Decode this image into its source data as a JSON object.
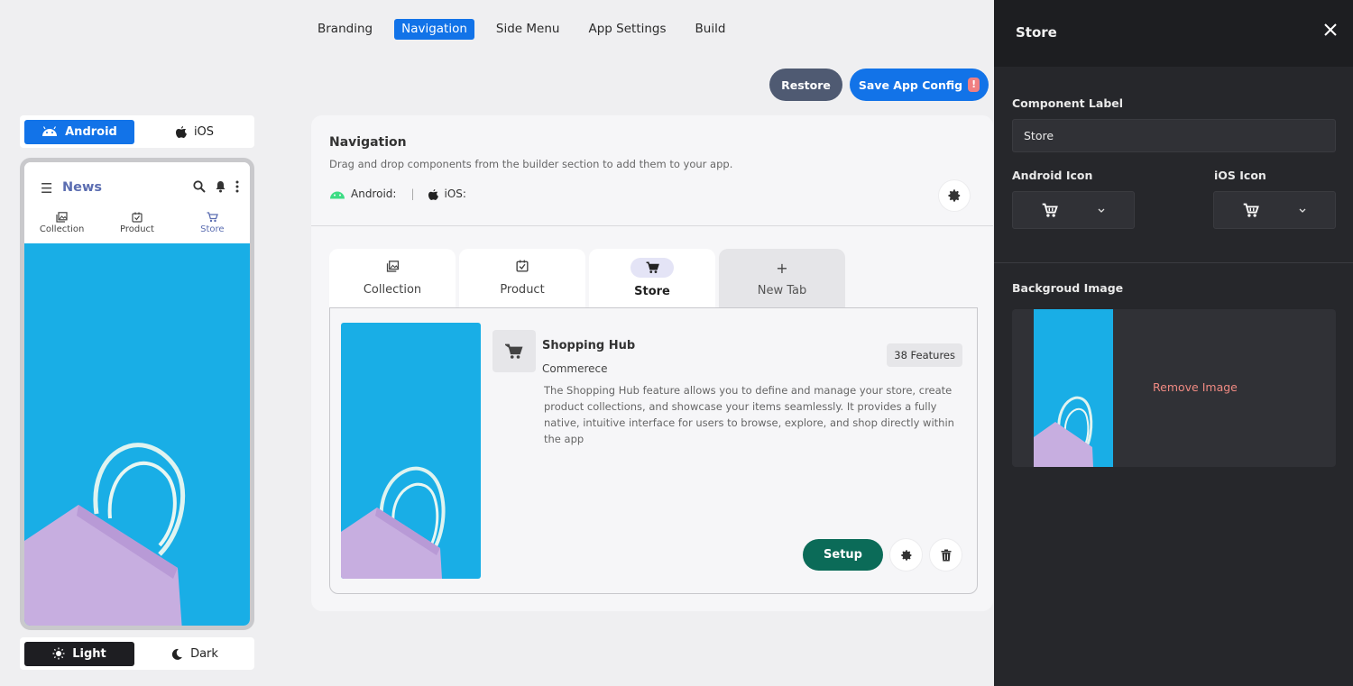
{
  "top_tabs": [
    {
      "label": "Branding"
    },
    {
      "label": "Navigation",
      "active": true
    },
    {
      "label": "Side Menu"
    },
    {
      "label": "App Settings"
    },
    {
      "label": "Build"
    }
  ],
  "actions": {
    "restore": "Restore",
    "save": "Save App Config",
    "save_badge": "!"
  },
  "platform_toggle": {
    "android": "Android",
    "ios": "iOS"
  },
  "phone": {
    "title": "News",
    "tabs": [
      {
        "label": "Collection"
      },
      {
        "label": "Product"
      },
      {
        "label": "Store",
        "active": true
      }
    ]
  },
  "theme_toggle": {
    "light": "Light",
    "dark": "Dark"
  },
  "navigation": {
    "title": "Navigation",
    "subtitle": "Drag and drop components from the builder section to add them to your app.",
    "android_label": "Android:",
    "ios_label": "iOS:",
    "separator": "|",
    "tabs": [
      {
        "label": "Collection"
      },
      {
        "label": "Product"
      },
      {
        "label": "Store",
        "active": true
      },
      {
        "label": "New Tab",
        "plus": "+"
      }
    ],
    "feature": {
      "name": "Shopping Hub",
      "category": "Commerece",
      "badge": "38 Features",
      "description": "The Shopping Hub feature allows you to define and manage your store, create product collections, and showcase your items seamlessly. It provides a fully native, intuitive interface for users to browse, explore, and shop directly within the app",
      "setup": "Setup"
    }
  },
  "panel": {
    "title": "Store",
    "component_label_title": "Component Label",
    "component_label_value": "Store",
    "android_icon_title": "Android Icon",
    "ios_icon_title": "iOS Icon",
    "bg_image_title": "Backgroud Image",
    "remove_image": "Remove Image"
  },
  "colors": {
    "accent": "#1273e8",
    "restore": "#4f5a72",
    "setup": "#0b6b58",
    "panel_bg": "#26272b",
    "remove": "#ef8a82",
    "image_bg": "#19aee6"
  }
}
